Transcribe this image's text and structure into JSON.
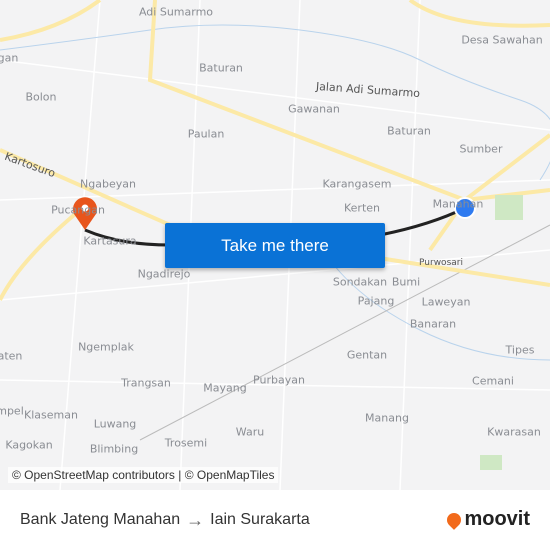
{
  "map": {
    "labels": [
      "Adi Sumarmo",
      "Desa Sawahan",
      "Baturan",
      "Jalan Adi Sumarmo",
      "Bolon",
      "Gawanan",
      "Baturan",
      "Paulan",
      "Sumber",
      "Kartosuro",
      "Ngabeyan",
      "Karangasem",
      "Kerten",
      "Manahan",
      "Pucangan",
      "Kartasura",
      "Ngadirejo",
      "Purwosari",
      "Sondakan",
      "Bumi",
      "Pajang",
      "Laweyan",
      "Banaran",
      "Gentan",
      "Tipes",
      "Ngemplak",
      "Trangsan",
      "Mayang",
      "Purbayan",
      "Cemani",
      "Klaseman",
      "Luwang",
      "Manang",
      "Kagokan",
      "Trosemi",
      "Waru",
      "Kwarasan",
      "Blimbing",
      "gan",
      "aten",
      "mpel"
    ],
    "origin_marker": "blue-dot",
    "destination_marker": "orange-pin",
    "colors": {
      "route": "#222222",
      "origin": "#2f7bf0",
      "destination": "#e8551c",
      "button": "#0a72d6",
      "roads": "#fce9a6"
    }
  },
  "cta_label": "Take me there",
  "attribution": "© OpenStreetMap contributors | © OpenMapTiles",
  "footer": {
    "from": "Bank Jateng Manahan",
    "arrow": "→",
    "to": "Iain Surakarta",
    "brand": "moovit"
  }
}
